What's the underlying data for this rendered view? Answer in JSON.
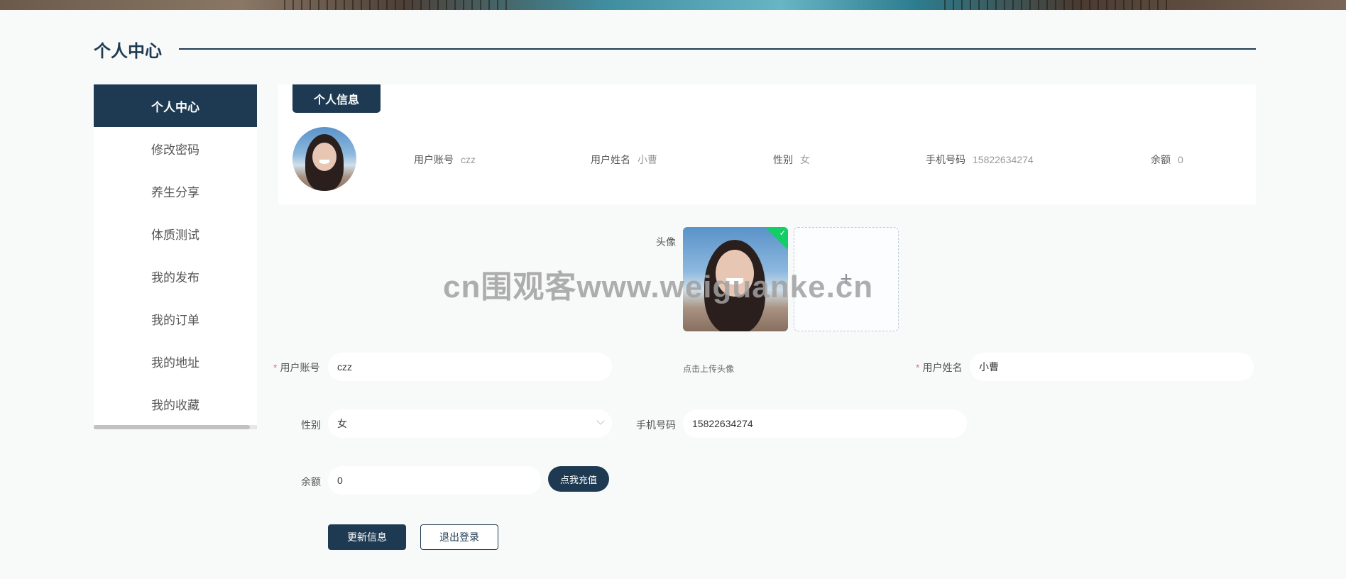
{
  "page": {
    "title": "个人中心"
  },
  "sidebar": {
    "items": [
      {
        "label": "个人中心",
        "active": true
      },
      {
        "label": "修改密码"
      },
      {
        "label": "养生分享"
      },
      {
        "label": "体质测试"
      },
      {
        "label": "我的发布"
      },
      {
        "label": "我的订单"
      },
      {
        "label": "我的地址"
      },
      {
        "label": "我的收藏"
      }
    ]
  },
  "info_card": {
    "tab_label": "个人信息",
    "fields": [
      {
        "label": "用户账号",
        "value": "czz"
      },
      {
        "label": "用户姓名",
        "value": "小曹"
      },
      {
        "label": "性别",
        "value": "女"
      },
      {
        "label": "手机号码",
        "value": "15822634274"
      },
      {
        "label": "余额",
        "value": "0"
      }
    ]
  },
  "form": {
    "avatar_label": "头像",
    "upload_plus": "+",
    "upload_hint": "点击上传头像",
    "required_mark": "*",
    "account": {
      "label": "用户账号",
      "value": "czz"
    },
    "name": {
      "label": "用户姓名",
      "value": "小曹"
    },
    "gender": {
      "label": "性别",
      "value": "女"
    },
    "phone": {
      "label": "手机号码",
      "value": "15822634274"
    },
    "balance": {
      "label": "余额",
      "value": "0"
    },
    "recharge_button": "点我充值",
    "update_button": "更新信息",
    "logout_button": "退出登录"
  },
  "watermark": "cn围观客www.weiguanke.cn",
  "colors": {
    "primary": "#1e3a52",
    "required": "#f56c6c",
    "success": "#13ce66"
  },
  "icons": {
    "upload_check": "check-icon",
    "select_arrow": "chevron-down-icon",
    "upload_plus": "plus-icon"
  }
}
